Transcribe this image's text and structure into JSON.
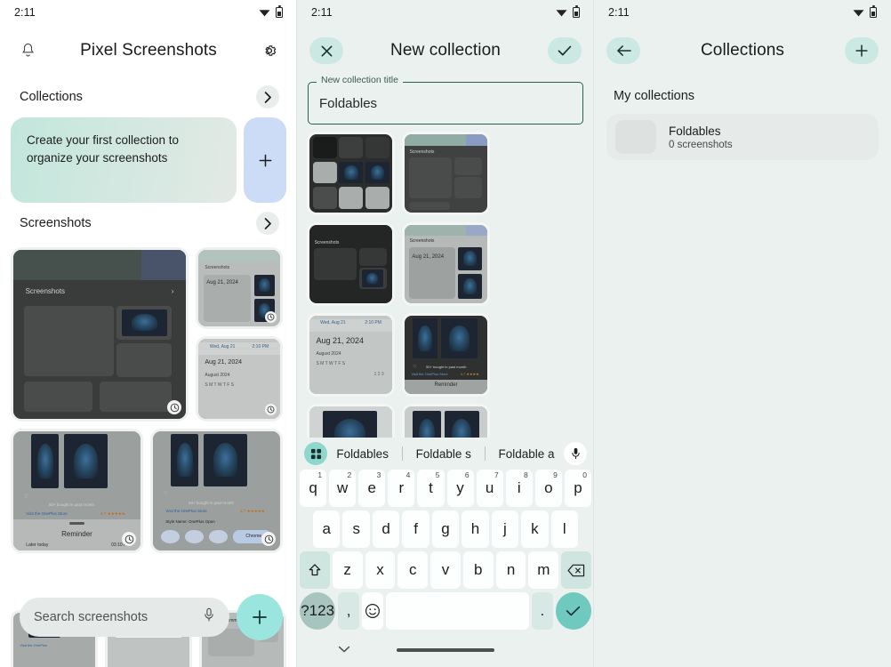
{
  "panel1": {
    "statusbar": {
      "time": "2:11",
      "wifi_icon": "wifi-icon",
      "battery_icon": "battery-icon"
    },
    "appbar": {
      "title": "Pixel Screenshots",
      "bell_icon": "bell-icon",
      "settings_icon": "gear-icon"
    },
    "collections_section": {
      "label": "Collections",
      "chevron_icon": "chevron-right-icon"
    },
    "promo": {
      "text": "Create your first collection to organize your screenshots",
      "add_icon": "plus-icon"
    },
    "screenshots_section": {
      "label": "Screenshots",
      "chevron_icon": "chevron-right-icon"
    },
    "search": {
      "placeholder": "Search screenshots",
      "mic_icon": "microphone-icon",
      "fab_icon": "plus-icon"
    }
  },
  "panel2": {
    "statusbar": {
      "time": "2:11",
      "wifi_icon": "wifi-icon",
      "battery_icon": "battery-icon"
    },
    "appbar": {
      "title": "New collection",
      "close_icon": "close-icon",
      "confirm_icon": "check-icon"
    },
    "textfield": {
      "label": "New collection title",
      "value": "Foldables"
    },
    "keyboard": {
      "suggestions": [
        "Foldables",
        "Foldable s",
        "Foldable a"
      ],
      "grid_icon": "keyboard-grid-icon",
      "mic_icon": "microphone-icon",
      "row1": [
        {
          "key": "q",
          "num": "1"
        },
        {
          "key": "w",
          "num": "2"
        },
        {
          "key": "e",
          "num": "3"
        },
        {
          "key": "r",
          "num": "4"
        },
        {
          "key": "t",
          "num": "5"
        },
        {
          "key": "y",
          "num": "6"
        },
        {
          "key": "u",
          "num": "7"
        },
        {
          "key": "i",
          "num": "8"
        },
        {
          "key": "o",
          "num": "9"
        },
        {
          "key": "p",
          "num": "0"
        }
      ],
      "row2": [
        "a",
        "s",
        "d",
        "f",
        "g",
        "h",
        "j",
        "k",
        "l"
      ],
      "row3": [
        "z",
        "x",
        "c",
        "v",
        "b",
        "n",
        "m"
      ],
      "shift_icon": "shift-icon",
      "backspace_icon": "backspace-icon",
      "symbols_label": "?123",
      "comma_label": ",",
      "emoji_icon": "emoji-icon",
      "space_label": "",
      "period_label": ".",
      "enter_icon": "check-icon",
      "hide_keyboard_icon": "chevron-down-icon"
    }
  },
  "panel3": {
    "statusbar": {
      "time": "2:11",
      "wifi_icon": "wifi-icon",
      "battery_icon": "battery-icon"
    },
    "appbar": {
      "title": "Collections",
      "back_icon": "arrow-left-icon",
      "add_icon": "plus-icon"
    },
    "section_label": "My collections",
    "collections": [
      {
        "name": "Foldables",
        "count": "0 screenshots"
      }
    ]
  },
  "colors": {
    "accent_teal": "#9ae6de",
    "panel_bg": "#eaf1ee",
    "promo_gradient_start": "#c2e6dc",
    "promo_add_bg": "#ccdcf6",
    "textfield_border": "#2c5f55",
    "key_bg": "#fdfefe",
    "key_fn_bg": "#cfe5e0",
    "enter_key_bg": "#6fc9bf"
  }
}
